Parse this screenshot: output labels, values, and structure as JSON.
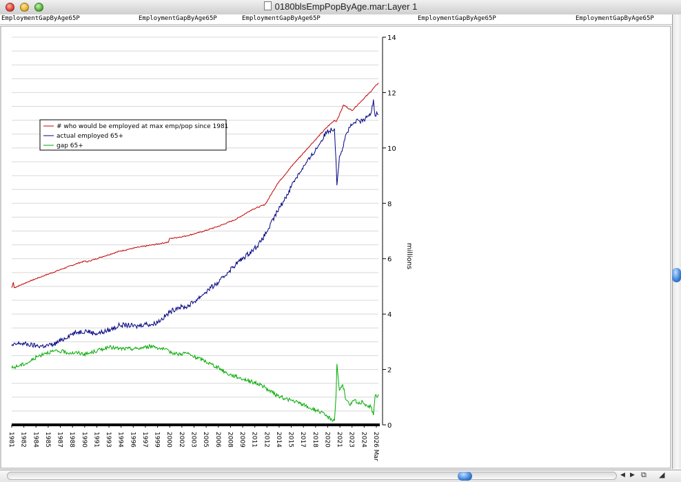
{
  "window": {
    "title": "0180blsEmpPopByAge.mar:Layer 1"
  },
  "ruler": {
    "labels": [
      "EmploymentGapByAge65P",
      "EmploymentGapByAge65P",
      "EmploymentGapByAge65P",
      "EmploymentGapByAge65P",
      "EmploymentGapByAge65P"
    ]
  },
  "colors": {
    "max": "#c00000",
    "actual": "#000080",
    "gap": "#00aa00"
  },
  "icons": [
    "close-icon",
    "minimize-icon",
    "zoom-icon",
    "document-icon",
    "scroll-left-icon",
    "scroll-right-icon",
    "collapse-icon",
    "resize-icon"
  ],
  "chart_data": {
    "type": "line",
    "ylabel": "millions",
    "ylim": [
      0,
      14
    ],
    "yticks": [
      0,
      2,
      4,
      6,
      8,
      10,
      12,
      14
    ],
    "xlim": [
      1981.0,
      2025.2
    ],
    "xticks": [
      "1981",
      "1982",
      "1984",
      "1985",
      "1987",
      "1988",
      "1990",
      "1991",
      "1993",
      "1994",
      "1996",
      "1997",
      "1999",
      "2000",
      "2002",
      "2003",
      "2005",
      "2006",
      "2008",
      "2009",
      "2011",
      "2012",
      "2014",
      "2015",
      "2017",
      "2018",
      "2020",
      "2021",
      "2023",
      "2024",
      "2026 Mar"
    ],
    "legend_position": "upper-left",
    "grid": true,
    "series": [
      {
        "name": "# who would be employed at max emp/pop since 1981",
        "x": [
          1981.0,
          1981.2,
          1981.3,
          1983,
          1985,
          1987,
          1989,
          1989.9,
          1990.0,
          1992,
          1994,
          1996,
          1998,
          1999.9,
          2000.0,
          2002,
          2004,
          2006,
          2008,
          2010,
          2011.5,
          2011.8,
          2013,
          2015,
          2017,
          2019,
          2019.9,
          2020.1,
          2020.5,
          2021.0,
          2022,
          2023,
          2024,
          2025.2
        ],
        "y": [
          4.95,
          5.15,
          4.95,
          5.17,
          5.4,
          5.62,
          5.84,
          5.92,
          5.88,
          6.08,
          6.27,
          6.4,
          6.5,
          6.6,
          6.72,
          6.82,
          6.98,
          7.18,
          7.42,
          7.78,
          7.95,
          8.08,
          8.7,
          9.43,
          10.1,
          10.75,
          11.0,
          10.95,
          11.2,
          11.55,
          11.35,
          11.65,
          11.95,
          12.35
        ]
      },
      {
        "name": "actual employed 65+",
        "x": [
          1981.0,
          1982,
          1983,
          1984,
          1985,
          1986,
          1987,
          1988,
          1989,
          1990,
          1991,
          1992,
          1993,
          1994,
          1995,
          1996,
          1997,
          1998,
          1999,
          2000,
          2001,
          2002,
          2003,
          2004,
          2005,
          2006,
          2007,
          2008,
          2009,
          2010,
          2011,
          2012,
          2013,
          2014,
          2015,
          2016,
          2017,
          2018,
          2019,
          2019.9,
          2020.1,
          2020.2,
          2020.5,
          2020.9,
          2021.3,
          2021.8,
          2022.3,
          2022.8,
          2023.3,
          2023.8,
          2024.3,
          2024.6,
          2024.8,
          2025.0,
          2025.2
        ],
        "y": [
          2.85,
          2.95,
          2.9,
          2.85,
          2.85,
          2.9,
          3.05,
          3.25,
          3.35,
          3.4,
          3.3,
          3.35,
          3.45,
          3.6,
          3.6,
          3.55,
          3.65,
          3.62,
          3.8,
          4.05,
          4.25,
          4.25,
          4.45,
          4.7,
          4.95,
          5.15,
          5.5,
          5.8,
          6.05,
          6.3,
          6.6,
          7.1,
          7.7,
          8.2,
          8.8,
          9.25,
          9.65,
          10.1,
          10.6,
          10.7,
          9.5,
          8.65,
          9.7,
          10.0,
          10.5,
          10.75,
          10.9,
          11.0,
          10.95,
          11.1,
          11.25,
          11.75,
          11.15,
          11.3,
          11.2
        ]
      },
      {
        "name": "gap 65+",
        "x": [
          1981.0,
          1982,
          1983,
          1984,
          1985,
          1986,
          1987,
          1988,
          1989,
          1990,
          1991,
          1992,
          1993,
          1994,
          1995,
          1996,
          1997,
          1998,
          1999,
          2000,
          2001,
          2002,
          2003,
          2004,
          2005,
          2006,
          2007,
          2008,
          2009,
          2010,
          2011,
          2012,
          2013,
          2014,
          2015,
          2016,
          2017,
          2018,
          2019,
          2019.9,
          2020.1,
          2020.2,
          2020.5,
          2020.9,
          2021.3,
          2021.8,
          2022.3,
          2022.8,
          2023.3,
          2023.8,
          2024.3,
          2024.6,
          2024.8,
          2025.0,
          2025.2
        ],
        "y": [
          2.05,
          2.15,
          2.25,
          2.45,
          2.6,
          2.65,
          2.65,
          2.6,
          2.6,
          2.55,
          2.65,
          2.75,
          2.8,
          2.75,
          2.75,
          2.75,
          2.8,
          2.85,
          2.75,
          2.65,
          2.55,
          2.6,
          2.45,
          2.35,
          2.2,
          2.05,
          1.85,
          1.75,
          1.65,
          1.55,
          1.45,
          1.25,
          1.05,
          0.95,
          0.85,
          0.75,
          0.6,
          0.5,
          0.3,
          0.15,
          1.1,
          2.2,
          1.25,
          1.45,
          0.9,
          0.7,
          0.9,
          0.75,
          0.85,
          0.7,
          0.65,
          0.35,
          1.05,
          1.0,
          1.1
        ]
      }
    ]
  }
}
